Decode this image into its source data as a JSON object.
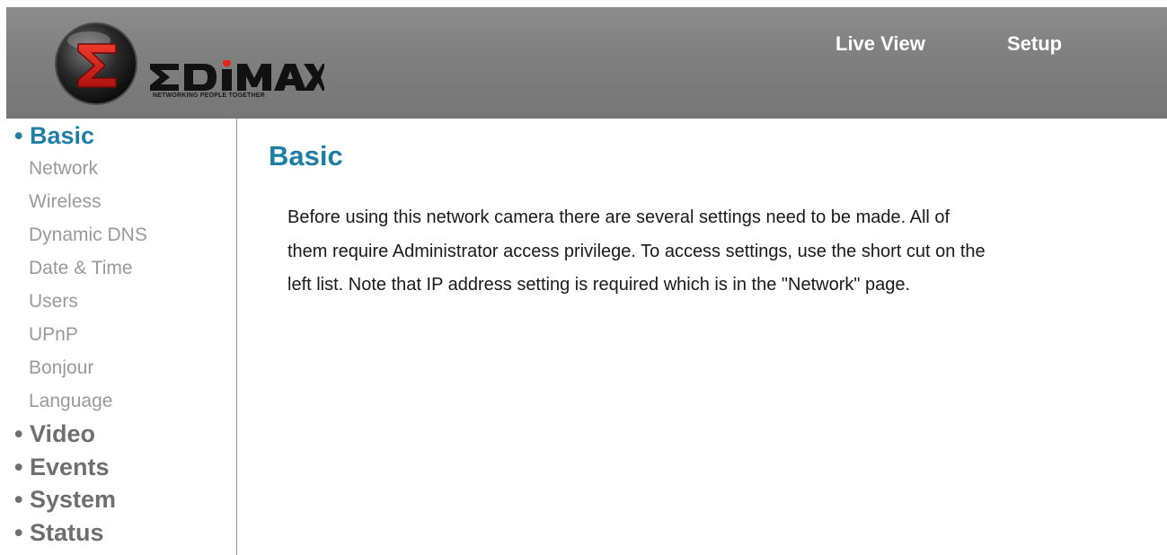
{
  "brand": {
    "name": "EDIMAX",
    "tagline": "NETWORKING PEOPLE TOGETHER",
    "accent_color": "#e52420"
  },
  "top_nav": {
    "live_view": "Live View",
    "setup": "Setup"
  },
  "sidebar": {
    "active_section": "• Basic",
    "basic_items": [
      "Network",
      "Wireless",
      "Dynamic DNS",
      "Date & Time",
      "Users",
      "UPnP",
      "Bonjour",
      "Language"
    ],
    "sections": [
      "• Video",
      "• Events",
      "• System",
      "• Status"
    ]
  },
  "main": {
    "title": "Basic",
    "description": "Before using this network camera there are several settings need to be made. All of them require Administrator access privilege. To access settings, use the short cut on the left list. Note that IP address setting is required which is in the \"Network\" page."
  },
  "colors": {
    "header_bg": "#808080",
    "active_blue": "#1d7fa5",
    "section_gray": "#6f6f6f",
    "sub_gray": "#9a9a9a"
  }
}
